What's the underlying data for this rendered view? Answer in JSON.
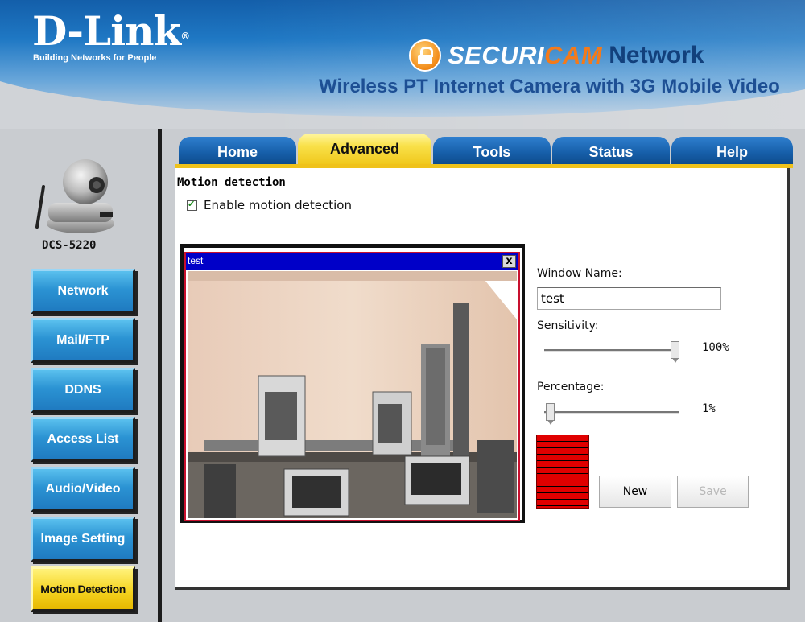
{
  "header": {
    "brand": "D-Link",
    "brand_mark": "®",
    "tagline": "Building Networks for People",
    "product_line_a": "SECURI",
    "product_line_b": "CAM",
    "product_line_c": "Network",
    "product_title": "Wireless PT Internet Camera with 3G Mobile Video"
  },
  "sidebar": {
    "model": "DCS-5220",
    "items": [
      {
        "label": "Network"
      },
      {
        "label": "Mail/FTP"
      },
      {
        "label": "DDNS"
      },
      {
        "label": "Access List"
      },
      {
        "label": "Audio/Video"
      },
      {
        "label": "Image Setting"
      },
      {
        "label": "Motion Detection",
        "active": true
      }
    ]
  },
  "tabs": [
    {
      "label": "Home"
    },
    {
      "label": "Advanced",
      "active": true
    },
    {
      "label": "Tools"
    },
    {
      "label": "Status"
    },
    {
      "label": "Help"
    }
  ],
  "main": {
    "section_title": "Motion detection",
    "enable_label": "Enable motion detection",
    "enable_checked": true,
    "motion_window": {
      "title": "test",
      "close": "x"
    },
    "window_name_label": "Window Name:",
    "window_name_value": "test",
    "sensitivity_label": "Sensitivity:",
    "sensitivity_value": "100%",
    "sensitivity_level": 1.0,
    "percentage_label": "Percentage:",
    "percentage_value": "1%",
    "percentage_level": 0.01,
    "new_button": "New",
    "save_button": "Save"
  },
  "colors": {
    "header_blue": "#1f78c4",
    "tab_active": "#f9e14a",
    "motion_window_bar": "#0000c8",
    "meter_red": "#e00000"
  }
}
